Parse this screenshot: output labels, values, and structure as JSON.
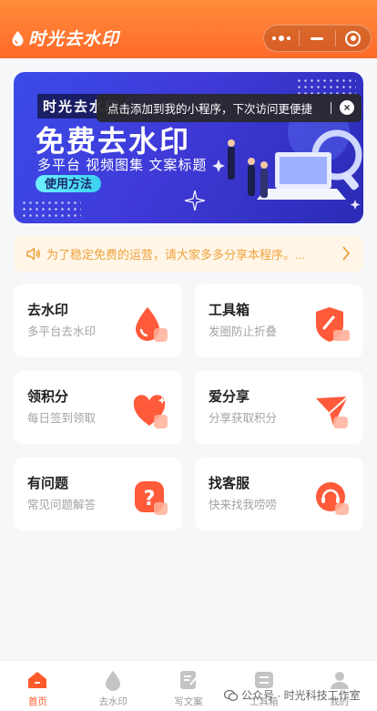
{
  "header": {
    "app_name": "时光去水印",
    "colors": {
      "accent": "#ff6a2a",
      "accent_light": "#ff8c3a"
    }
  },
  "capsule": {
    "more_icon": "more-dots-icon",
    "minimize_icon": "minus-icon",
    "close_icon": "target-icon"
  },
  "banner": {
    "brand": "时光去水印",
    "headline": "免费去水印",
    "subtitle": "多平台 视频图集 文案标题",
    "method_button": "使用方法"
  },
  "tooltip": {
    "text": "点击添加到我的小程序，下次访问更便捷",
    "close_label": "×"
  },
  "notice": {
    "icon": "speaker-icon",
    "text": "为了稳定免费的运营，请大家多多分享本程序。...",
    "chevron_icon": "chevron-right-icon"
  },
  "cards": [
    {
      "title": "去水印",
      "subtitle": "多平台去水印",
      "icon": "drop-icon"
    },
    {
      "title": "工具箱",
      "subtitle": "发圈防止折叠",
      "icon": "shield-tool-icon"
    },
    {
      "title": "领积分",
      "subtitle": "每日签到领取",
      "icon": "heart-icon"
    },
    {
      "title": "爱分享",
      "subtitle": "分享获取积分",
      "icon": "share-icon"
    },
    {
      "title": "有问题",
      "subtitle": "常见问题解答",
      "icon": "question-icon"
    },
    {
      "title": "找客服",
      "subtitle": "快来找我唠唠",
      "icon": "headset-icon"
    }
  ],
  "tabbar": [
    {
      "label": "首页",
      "icon": "home-icon",
      "active": true
    },
    {
      "label": "去水印",
      "icon": "drop-icon",
      "active": false
    },
    {
      "label": "写文案",
      "icon": "edit-icon",
      "active": false
    },
    {
      "label": "工具箱",
      "icon": "toolbox-icon",
      "active": false
    },
    {
      "label": "我的",
      "icon": "user-icon",
      "active": false
    }
  ],
  "watermark": {
    "text": "公众号 · 时光科技工作室"
  }
}
